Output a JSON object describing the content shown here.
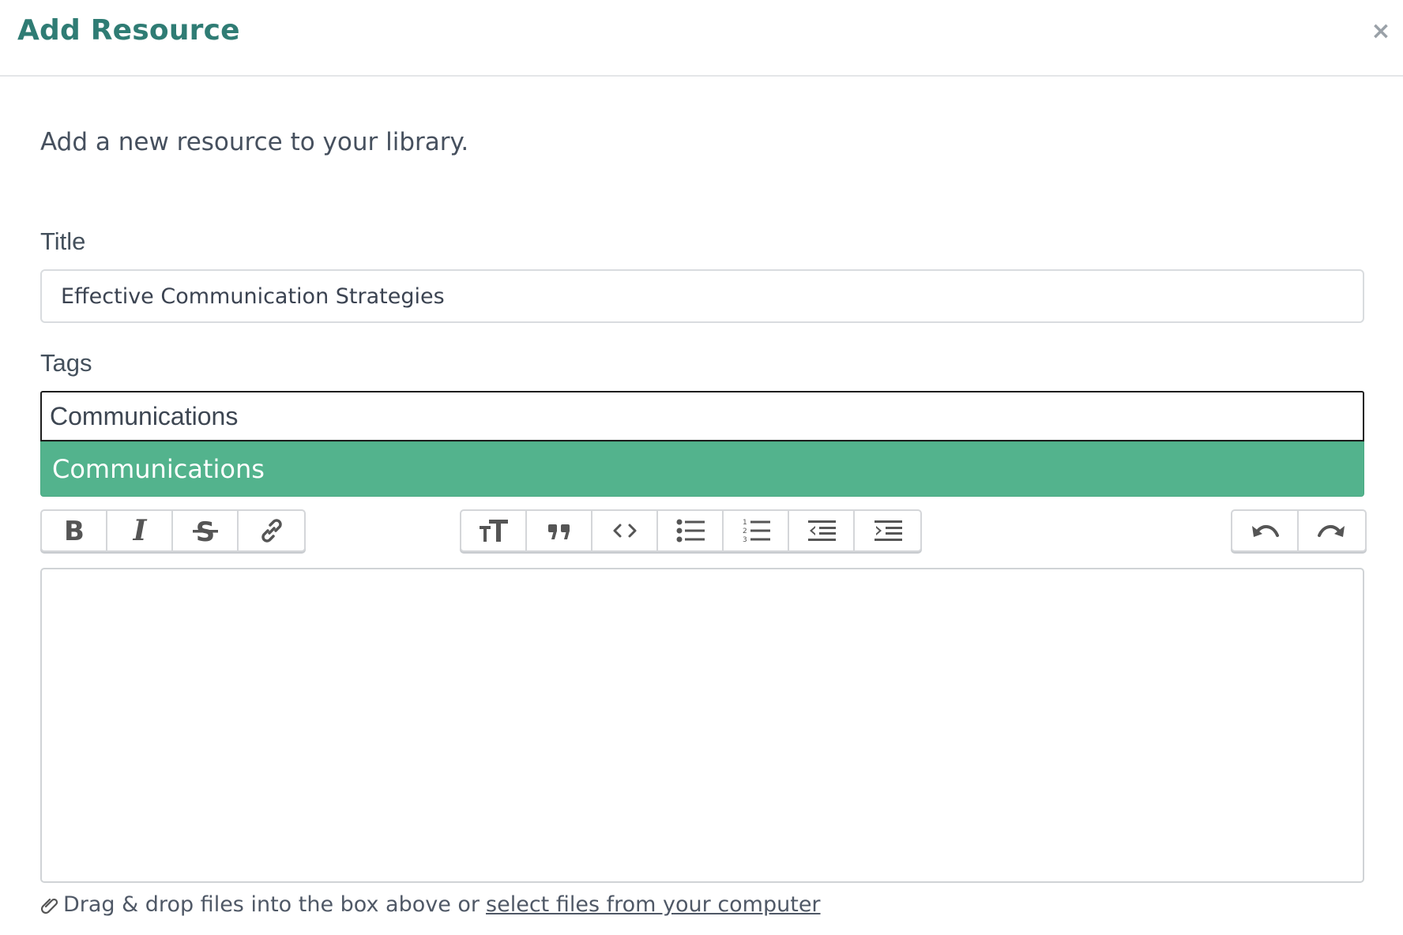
{
  "modal": {
    "title": "Add Resource",
    "close_label": "×",
    "intro": "Add a new resource to your library."
  },
  "form": {
    "title_label": "Title",
    "title_value": "Effective Communication Strategies",
    "tags_label": "Tags",
    "tags_value": "Communications",
    "tag_suggestion": "Communications",
    "suggestion_color": "#53b38d"
  },
  "toolbar": {
    "text_format": [
      "bold-icon",
      "italic-icon",
      "strikethrough-icon",
      "link-icon"
    ],
    "blocks": [
      "heading-icon",
      "quote-icon",
      "code-icon",
      "bullet-list-icon",
      "numbered-list-icon",
      "outdent-icon",
      "indent-icon"
    ],
    "history": [
      "undo-icon",
      "redo-icon"
    ]
  },
  "footer": {
    "icon": "paperclip-icon",
    "text": "Drag & drop files into the box above or",
    "link": "select files from your computer"
  },
  "colors": {
    "title": "#2f7c74",
    "accent": "#53b38d"
  }
}
